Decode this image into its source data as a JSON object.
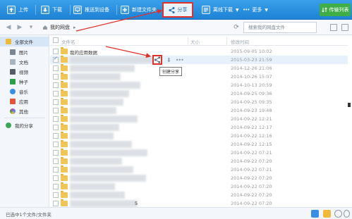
{
  "toolbar": {
    "upload": "上传",
    "download": "下载",
    "push_device": "推送到设备",
    "new_folder": "新建文件夹",
    "share": "分享",
    "offline_download": "离线下载",
    "more": "更多",
    "transfer_list": "传输列表"
  },
  "addressbar": {
    "breadcrumb": "我的网盘",
    "search_placeholder": "搜索我的网盘文件"
  },
  "sidebar": {
    "items": [
      {
        "label": "全部文件",
        "icon": "folder-icon",
        "color": "#f1b93c"
      },
      {
        "label": "图片",
        "icon": "image-icon",
        "color": "#7a8793"
      },
      {
        "label": "文档",
        "icon": "doc-icon",
        "color": "#7a8793"
      },
      {
        "label": "视频",
        "icon": "video-icon",
        "color": "#555e68"
      },
      {
        "label": "种子",
        "icon": "bt-icon",
        "color": "#2e9c4a"
      },
      {
        "label": "音乐",
        "icon": "music-icon",
        "color": "#3a8ee6"
      },
      {
        "label": "应用",
        "icon": "app-icon",
        "color": "#e0583a"
      },
      {
        "label": "其他",
        "icon": "other-icon",
        "color": "#d04ac6"
      },
      {
        "label": "我的分享",
        "icon": "share-icon",
        "color": "#3aa655"
      }
    ]
  },
  "list": {
    "headers": {
      "name": "文件名",
      "size": "大小",
      "date": "修改时间"
    },
    "tooltip": "创建分享",
    "rows": [
      {
        "name": "我的应用数据",
        "date": "2015-09-05 10:02",
        "checked": false
      },
      {
        "name": "",
        "date": "2015-03-23 21:59",
        "checked": true
      },
      {
        "name": "",
        "date": "2014-12-26 21:06",
        "checked": false
      },
      {
        "name": "",
        "date": "2014-10-26 15:07",
        "checked": false
      },
      {
        "name": "",
        "date": "2014-10-13 20:59",
        "checked": false
      },
      {
        "name": "",
        "date": "2014-09-25 09:36",
        "checked": false
      },
      {
        "name": "",
        "date": "2014-09-25 09:35",
        "checked": false
      },
      {
        "name": "",
        "date": "2014-09-23 19:48",
        "checked": false
      },
      {
        "name": "",
        "date": "2014-09-22 12:21",
        "checked": false
      },
      {
        "name": "",
        "date": "2014-09-22 12:17",
        "checked": false
      },
      {
        "name": "",
        "date": "2014-09-22 12:16",
        "checked": false
      },
      {
        "name": "",
        "date": "2014-09-22 12:15",
        "checked": false
      },
      {
        "name": "",
        "date": "2014-09-22 07:21",
        "checked": false
      },
      {
        "name": "",
        "date": "2014-09-22 07:20",
        "checked": false
      },
      {
        "name": "",
        "date": "2014-09-22 07:21",
        "checked": false
      },
      {
        "name": "",
        "date": "2014-09-22 07:20",
        "checked": false
      },
      {
        "name": "",
        "date": "2014-09-22 07:20",
        "checked": false
      },
      {
        "name": "",
        "date": "2014-09-22 07:20",
        "checked": false
      },
      {
        "name": "5",
        "date": "2014-09-22 07:20",
        "checked": false
      },
      {
        "name": "",
        "date": "2014-09-22 07:21",
        "checked": false
      }
    ]
  },
  "status": {
    "text": "已选中1个文件/文件夹"
  },
  "colors": {
    "toolbar_blue": "#1f82d6",
    "annotation_red": "#e0302a",
    "selection": "#e6f1fb",
    "transfer_green": "#3fae49"
  }
}
